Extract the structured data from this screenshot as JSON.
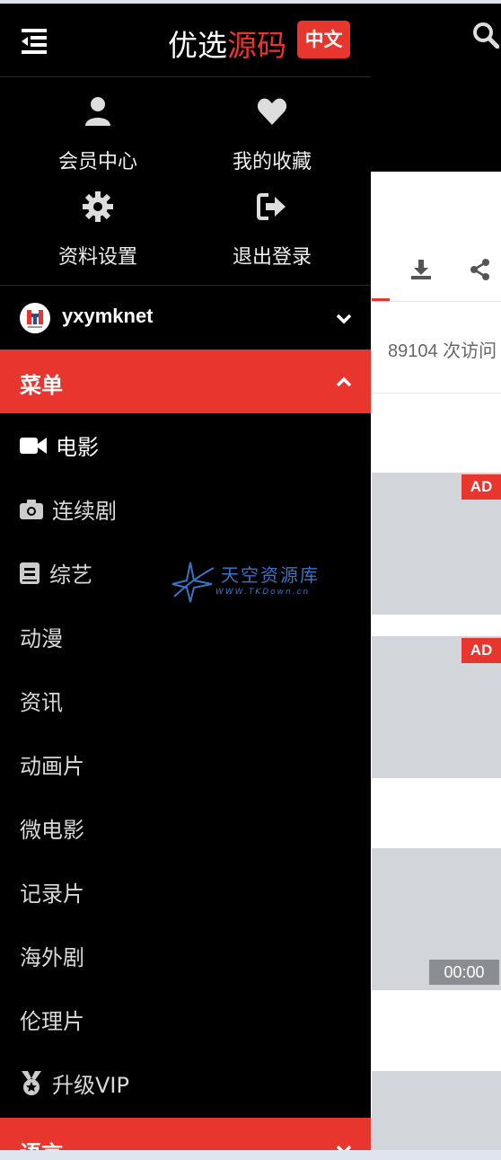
{
  "brand": {
    "part1": "优选",
    "part2": "源码",
    "lang_badge": "中文"
  },
  "quick_links": [
    {
      "label": "会员中心",
      "icon": "user-icon"
    },
    {
      "label": "我的收藏",
      "icon": "heart-icon"
    },
    {
      "label": "资料设置",
      "icon": "gear-icon"
    },
    {
      "label": "退出登录",
      "icon": "sign-out-icon"
    }
  ],
  "user": {
    "name": "yxymknet"
  },
  "menu_section": {
    "label": "菜单"
  },
  "menu_items": [
    {
      "label": "电影",
      "icon": "video-camera-icon"
    },
    {
      "label": "连续剧",
      "icon": "camera-icon"
    },
    {
      "label": "综艺",
      "icon": "book-icon"
    },
    {
      "label": "动漫"
    },
    {
      "label": "资讯"
    },
    {
      "label": "动画片"
    },
    {
      "label": "微电影"
    },
    {
      "label": "记录片"
    },
    {
      "label": "海外剧"
    },
    {
      "label": "伦理片"
    },
    {
      "label": "升级VIP",
      "icon": "medal-icon"
    }
  ],
  "language_section": {
    "label": "语言"
  },
  "watermark": {
    "title": "天空资源库",
    "url": "WWW.TKDown.cn"
  },
  "background_page": {
    "visits": "89104 次访问",
    "ad_label": "AD",
    "duration": "00:00"
  },
  "colors": {
    "accent": "#e8352e",
    "drawer_bg": "#000000",
    "card_bg": "#d2d6da"
  }
}
